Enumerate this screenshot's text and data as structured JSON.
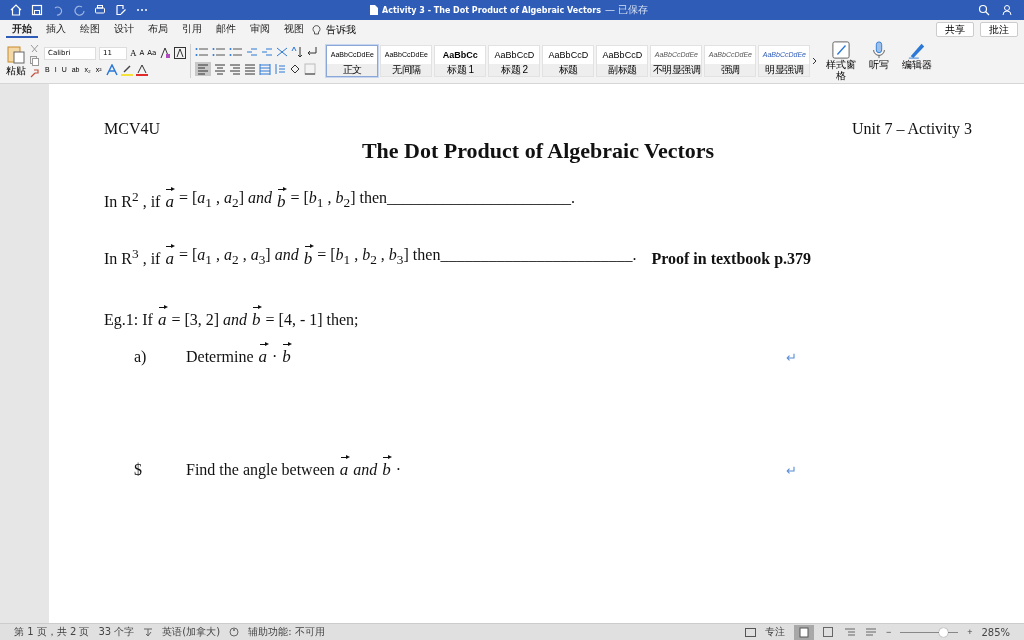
{
  "window": {
    "title": "Activity 3 - The Dot Product of Algebraic Vectors",
    "save_state": "— 已保存"
  },
  "ribbon_tabs": [
    {
      "label": "开始",
      "selected": true
    },
    {
      "label": "插入",
      "selected": false
    },
    {
      "label": "绘图",
      "selected": false
    },
    {
      "label": "设计",
      "selected": false
    },
    {
      "label": "布局",
      "selected": false
    },
    {
      "label": "引用",
      "selected": false
    },
    {
      "label": "邮件",
      "selected": false
    },
    {
      "label": "审阅",
      "selected": false
    },
    {
      "label": "视图",
      "selected": false
    }
  ],
  "tell_me": "告诉我",
  "share": "共享",
  "comments": "批注",
  "paste": "粘贴",
  "font": {
    "name": "Calibri",
    "size": "11"
  },
  "format_buttons": [
    "B",
    "I",
    "U",
    "ab",
    "x₂",
    "x²"
  ],
  "grow_font": "A",
  "shrink_font": "A",
  "change_case": "Aa",
  "styles": [
    {
      "preview": "AaBbCcDdEe",
      "name": "正文",
      "kind": "small",
      "selected": true
    },
    {
      "preview": "AaBbCcDdEe",
      "name": "无间隔",
      "kind": "small",
      "selected": false
    },
    {
      "preview": "AaBbCc",
      "name": "标题 1",
      "kind": "bold",
      "selected": false
    },
    {
      "preview": "AaBbCcD",
      "name": "标题 2",
      "kind": "normal",
      "selected": false
    },
    {
      "preview": "AaBbCcD",
      "name": "标题",
      "kind": "normal",
      "selected": false
    },
    {
      "preview": "AaBbCcD",
      "name": "副标题",
      "kind": "normal",
      "selected": false
    },
    {
      "preview": "AaBbCcDdEe",
      "name": "不明显强调",
      "kind": "italic",
      "selected": false
    },
    {
      "preview": "AaBbCcDdEe",
      "name": "强调",
      "kind": "italic",
      "selected": false
    },
    {
      "preview": "AaBbCcDdEe",
      "name": "明显强调",
      "kind": "accent",
      "selected": false
    }
  ],
  "right_tools": [
    "样式窗格",
    "听写",
    "编辑器"
  ],
  "document": {
    "header_left": "MCV4U",
    "header_right": "Unit 7 – Activity 3",
    "title": "The Dot Product of Algebraic Vectors",
    "lines": [
      {
        "segments": [
          {
            "kind": "text",
            "text": "In R$^{2}$ , if"
          },
          {
            "kind": "vector",
            "text": "a"
          },
          {
            "kind": "text",
            "text": "= [*a*$_{1}$ , *a*$_{2}$] *and*"
          },
          {
            "kind": "vector",
            "text": "b"
          },
          {
            "kind": "text",
            "text": "= [*b*$_{1}$ , *b*$_{2}$] then_______________________."
          }
        ]
      },
      {
        "segments": [
          {
            "kind": "text",
            "text": "In R$^{3}$ , if"
          },
          {
            "kind": "vector",
            "text": "a"
          },
          {
            "kind": "text",
            "text": "= [*a*$_{1}$ , *a*$_{2}$ , *a*$_{3}$] *and*"
          },
          {
            "kind": "vector",
            "text": "b"
          },
          {
            "kind": "text",
            "text": "= [*b*$_{1}$ , *b*$_{2}$ , *b*$_{3}$] then________________________."
          },
          {
            "kind": "bold",
            "text": "Proof in textbook p.379"
          }
        ]
      },
      {
        "segments": [
          {
            "kind": "text",
            "text": "Eg.1:  If"
          },
          {
            "kind": "vector",
            "text": "a"
          },
          {
            "kind": "text",
            "text": "= [3, 2] *and*"
          },
          {
            "kind": "vector",
            "text": "b"
          },
          {
            "kind": "text",
            "text": "= [4, - 1] then;"
          }
        ]
      }
    ],
    "items": [
      {
        "label": "a)",
        "segments": [
          {
            "kind": "text",
            "text": "Determine"
          },
          {
            "kind": "vector",
            "text": "a"
          },
          {
            "kind": "text",
            "text": "·"
          },
          {
            "kind": "vector",
            "text": "b"
          }
        ],
        "mark": "↵"
      },
      {
        "label": "$",
        "segments": [
          {
            "kind": "text",
            "text": "Find the angle between"
          },
          {
            "kind": "vector",
            "text": "a"
          },
          {
            "kind": "text",
            "text": "*and*"
          },
          {
            "kind": "vector",
            "text": "b"
          },
          {
            "kind": "text",
            "text": "·"
          }
        ],
        "mark": "↵"
      }
    ]
  },
  "status_bar": {
    "page": "第 1 页，共 2 页",
    "words": "33 个字",
    "language": "英语(加拿大)",
    "accessibility": "辅助功能: 不可用",
    "focus": "专注",
    "zoom_out": "−",
    "zoom_slider": {
      "level": 0.75
    },
    "zoom_in": "+",
    "zoom": "285%"
  }
}
